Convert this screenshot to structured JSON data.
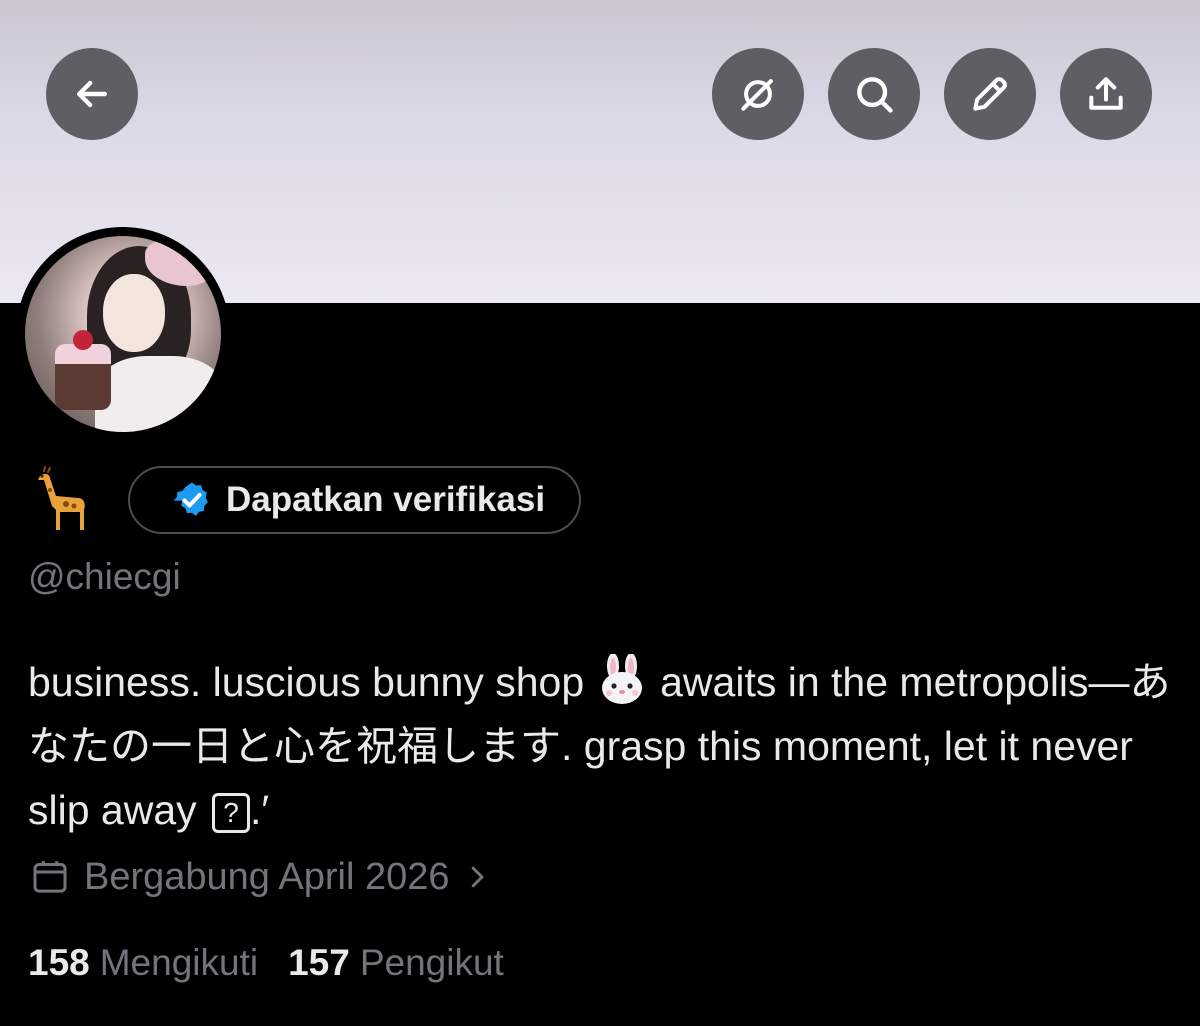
{
  "header": {
    "buttons": [
      {
        "name": "back-button",
        "icon": "arrow-left-icon"
      },
      {
        "name": "grok-button",
        "icon": "grok-icon"
      },
      {
        "name": "search-button",
        "icon": "search-icon"
      },
      {
        "name": "edit-button",
        "icon": "pencil-icon"
      },
      {
        "name": "share-button",
        "icon": "share-icon"
      }
    ],
    "button_color": "#54545a"
  },
  "profile": {
    "name_emoji": "giraffe",
    "verify_label": "Dapatkan verifikasi",
    "verify_badge_color": "#1d9bf0",
    "handle": "@chiecgi",
    "bio_part1": "business. luscious bunny shop",
    "bio_emoji": "rabbit-face",
    "bio_part2": "awaits in the metropolis—あなたの一日と心を祝福します. grasp this moment, let it never slip away",
    "bio_box": "?",
    "bio_end": ".′",
    "joined": "Bergabung April 2026",
    "following_count": "158",
    "following_label": "Mengikuti",
    "followers_count": "157",
    "followers_label": "Pengikut"
  },
  "colors": {
    "background": "#000000",
    "text_primary": "#e7e9ea",
    "text_secondary": "#71767b",
    "pill_border": "#4a4d52"
  }
}
